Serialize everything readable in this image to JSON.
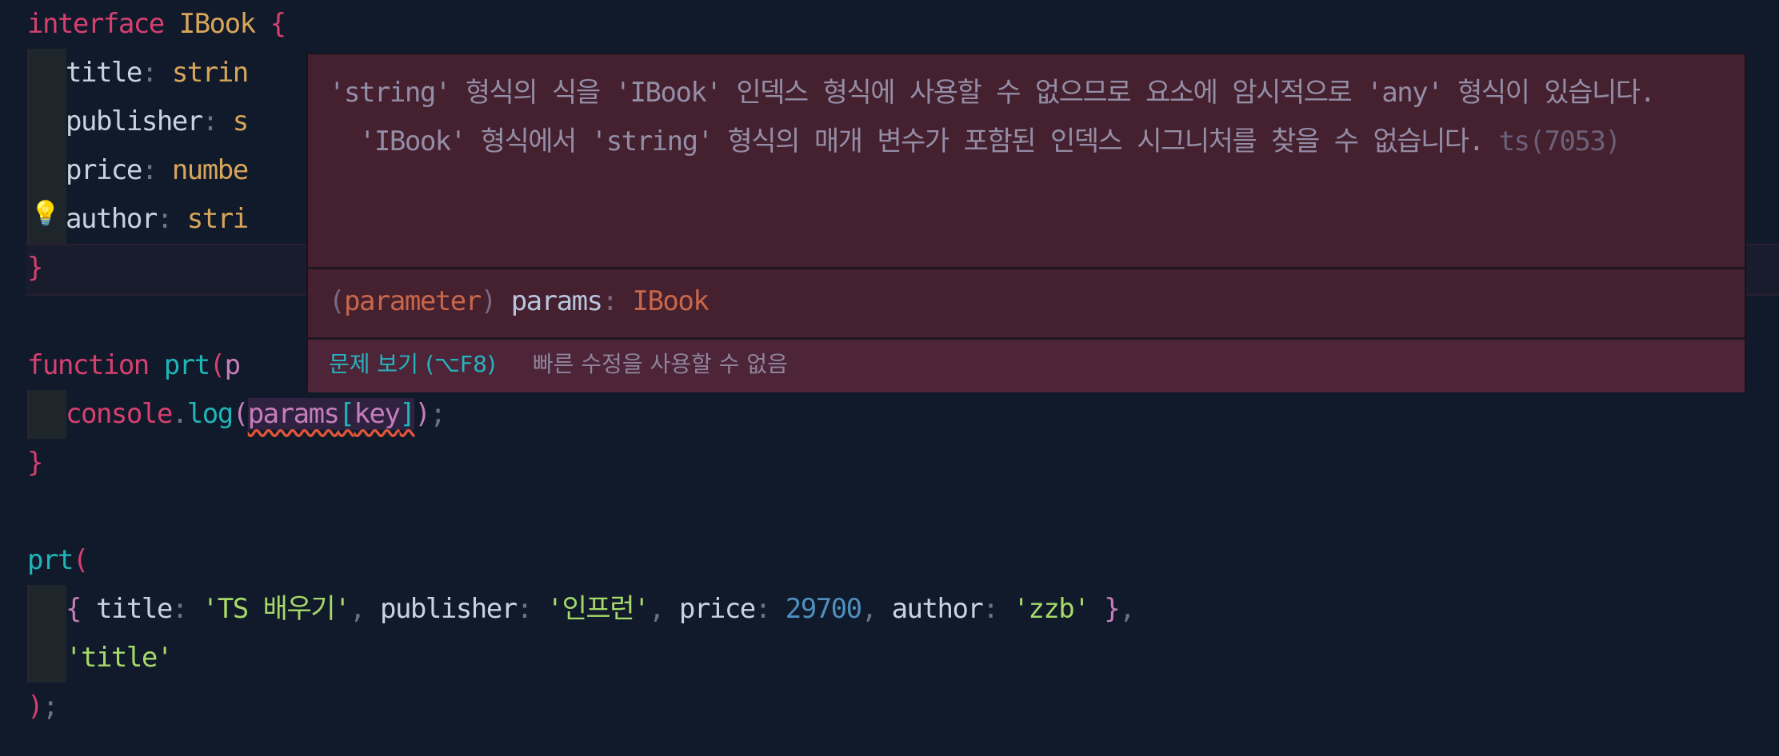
{
  "code": {
    "l1": {
      "kw": "interface",
      "name": "IBook",
      "brace": "{"
    },
    "l2": {
      "prop": "title",
      "colon": ":",
      "type": "strin"
    },
    "l3": {
      "prop": "publisher",
      "colon": ":",
      "type": "s"
    },
    "l4": {
      "prop": "price",
      "colon": ":",
      "type": "numbe"
    },
    "l5": {
      "prop": "author",
      "colon": ":",
      "type": "stri"
    },
    "l6": {
      "brace": "}"
    },
    "l8": {
      "kw": "function",
      "fn": "prt",
      "paren": "(",
      "rest": "p"
    },
    "l9": {
      "obj": "console",
      "dot": ".",
      "fn": "log",
      "open": "(",
      "err_obj": "params",
      "err_open": "[",
      "err_key": "key",
      "err_close": "]",
      "close": ")",
      "semi": ";"
    },
    "l10": {
      "brace": "}"
    },
    "l12": {
      "fn": "prt",
      "paren": "("
    },
    "l13": {
      "open": "{",
      "k1": "title",
      "v1": "'TS 배우기'",
      "k2": "publisher",
      "v2": "'인프런'",
      "k3": "price",
      "v3": "29700",
      "k4": "author",
      "v4": "'zzb'",
      "close": "}",
      "comma": ",",
      "colon": ":",
      "sep": ","
    },
    "l14": {
      "str": "'title'"
    },
    "l15": {
      "paren": ")",
      "semi": ";"
    }
  },
  "icons": {
    "lightbulb": "lightbulb-icon"
  },
  "tooltip": {
    "message_1": "'string' 형식의 식을 'IBook' 인덱스 형식에 사용할 수 없으므로 요소에 암시적으로 'any' 형식이 있습니다.",
    "message_2": "  'IBook' 형식에서 'string' 형식의 매개 변수가 포함된 인덱스 시그니처를 찾을 수 없습니다.",
    "code": "ts(7053)",
    "signature": {
      "open": "(",
      "kind": "parameter",
      "close": ")",
      "name": "params",
      "colon": ":",
      "type": "IBook"
    },
    "view_problem": "문제 보기 (⌥F8)",
    "no_quick_fix": "빠른 수정을 사용할 수 없음"
  },
  "colors": {
    "background": "#101a2a",
    "keyword": "#d6406f",
    "type": "#d9a55a",
    "function": "#1fb5b8",
    "string": "#a6d96a",
    "number": "#4e8fc0",
    "tooltip_bg": "#45202f",
    "error_squiggle": "#e0553a"
  }
}
